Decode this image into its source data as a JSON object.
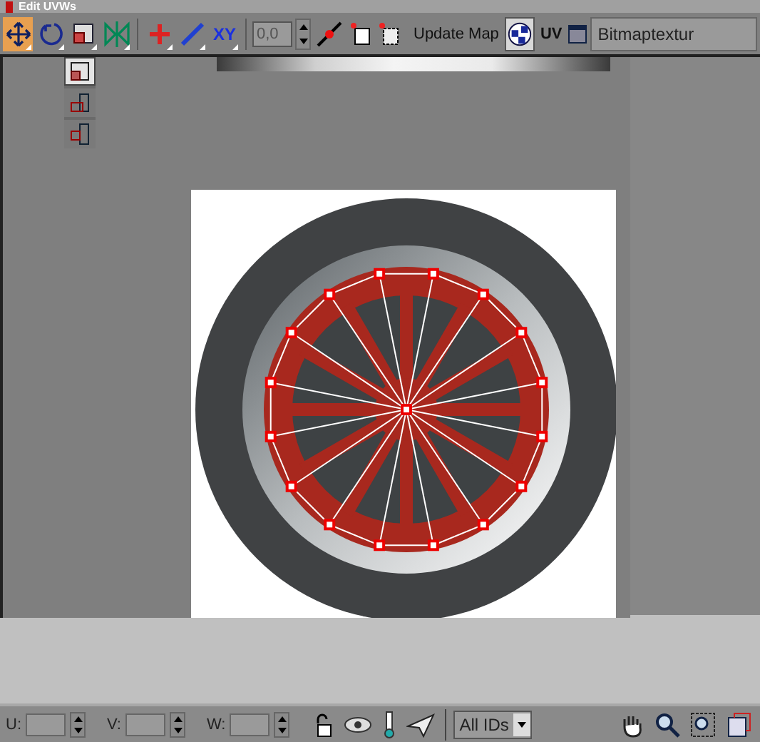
{
  "window": {
    "title": "Edit UVWs"
  },
  "toolbar": {
    "tools": [
      {
        "kind": "move",
        "selected": true
      },
      {
        "kind": "rotate",
        "selected": false
      },
      {
        "kind": "scale",
        "selected": false
      },
      {
        "kind": "mirror",
        "selected": false
      },
      {
        "kind": "sep"
      },
      {
        "kind": "freeform",
        "selected": false
      },
      {
        "kind": "line",
        "selected": false
      },
      {
        "kind": "xy",
        "label": "XY",
        "selected": false
      }
    ],
    "offset": {
      "value": "0,0"
    },
    "update_map": {
      "label": "Update Map"
    },
    "show_map": {
      "selected": true
    },
    "uv_button": {
      "label": "UV"
    },
    "texture_dropdown": {
      "value": "Bitmaptextur"
    }
  },
  "scale_flyout": [
    {
      "kind": "uniform",
      "selected": true
    },
    {
      "kind": "horizontal",
      "selected": false
    },
    {
      "kind": "vertical",
      "selected": false
    }
  ],
  "bottom_bar": {
    "coords": [
      {
        "label": "U:"
      },
      {
        "label": "V:"
      },
      {
        "label": "W:"
      }
    ],
    "id_filter": "All IDs"
  }
}
